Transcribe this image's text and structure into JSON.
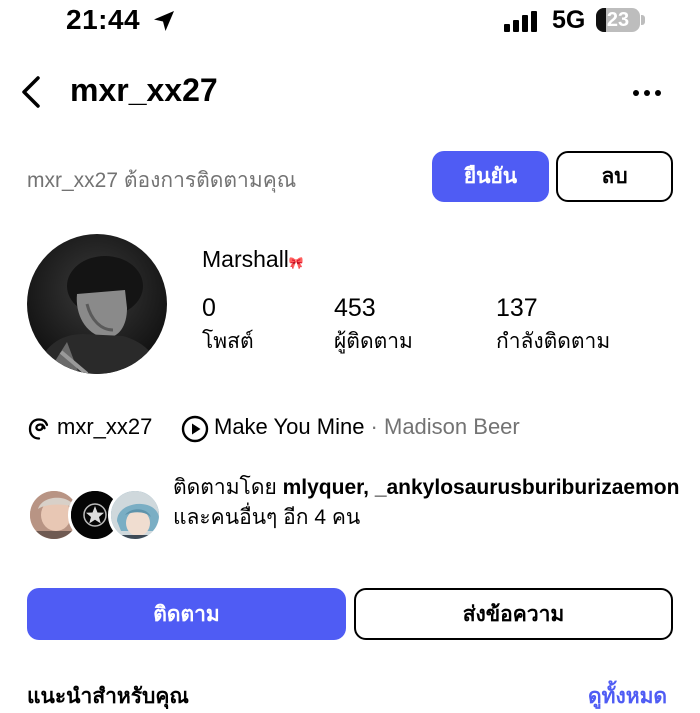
{
  "status_bar": {
    "time": "21:44",
    "network": "5G",
    "battery": "23",
    "battery_level": 0.23,
    "signal_bars": 4
  },
  "header": {
    "username": "mxr_xx27",
    "back_icon": "chevron-left-icon",
    "more_icon": "more-horizontal-icon"
  },
  "follow_request": {
    "text": "mxr_xx27 ต้องการติดตามคุณ",
    "confirm_label": "ยืนยัน",
    "delete_label": "ลบ"
  },
  "profile": {
    "display_name": "Marshall",
    "name_emoji": "🎀",
    "stats": [
      {
        "value": "0",
        "label": "โพสต์"
      },
      {
        "value": "453",
        "label": "ผู้ติดตาม"
      },
      {
        "value": "137",
        "label": "กำลังติดตาม"
      }
    ]
  },
  "bio": {
    "threads_handle": "mxr_xx27",
    "song_title": "Make You Mine",
    "song_separator": " · ",
    "song_artist": "Madison Beer"
  },
  "followed_by": {
    "prefix": "ติดตามโดย ",
    "names": "mlyquer, _ankylosaurusburiburizaemon",
    "suffix": " และคนอื่นๆ อีก 4 คน"
  },
  "actions": {
    "follow_label": "ติดตาม",
    "message_label": "ส่งข้อความ"
  },
  "suggestions": {
    "title": "แนะนำสำหรับคุณ",
    "see_all": "ดูทั้งหมด"
  },
  "colors": {
    "accent": "#4f5cf4",
    "muted": "#737373"
  }
}
